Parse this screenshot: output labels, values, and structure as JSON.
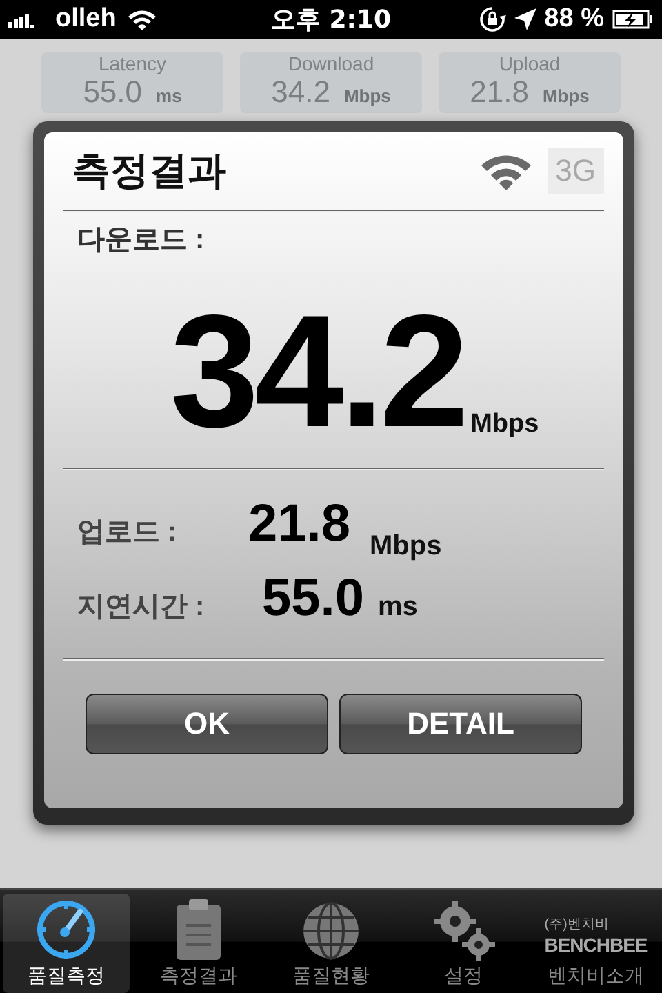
{
  "status_bar": {
    "carrier": "olleh",
    "time": "오후 2:10",
    "battery": "88 %"
  },
  "summary_cards": [
    {
      "label": "Latency",
      "value": "55.0",
      "unit": "ms"
    },
    {
      "label": "Download",
      "value": "34.2",
      "unit": "Mbps"
    },
    {
      "label": "Upload",
      "value": "21.8",
      "unit": "Mbps"
    }
  ],
  "dialog": {
    "title": "측정결과",
    "network": {
      "wifi": true,
      "cellular": false,
      "cellular_label": "3G"
    },
    "main": {
      "label": "다운로드 :",
      "value": "34.2",
      "unit": "Mbps"
    },
    "rows": [
      {
        "label": "업로드 :",
        "value": "21.8",
        "unit": "Mbps"
      },
      {
        "label": "지연시간 :",
        "value": "55.0",
        "unit": "ms"
      }
    ],
    "buttons": [
      "OK",
      "DETAIL"
    ]
  },
  "tab_bar": [
    {
      "kind": "gauge",
      "label": "품질측정",
      "selected": true
    },
    {
      "kind": "clipboard",
      "label": "측정결과",
      "selected": false
    },
    {
      "kind": "globe",
      "label": "품질현황",
      "selected": false
    },
    {
      "kind": "gears",
      "label": "설정",
      "selected": false
    },
    {
      "kind": "logo",
      "label": "벤치비소개",
      "selected": false,
      "logo_small": "(주)벤치비",
      "logo_text": "BENCHBEE"
    }
  ]
}
